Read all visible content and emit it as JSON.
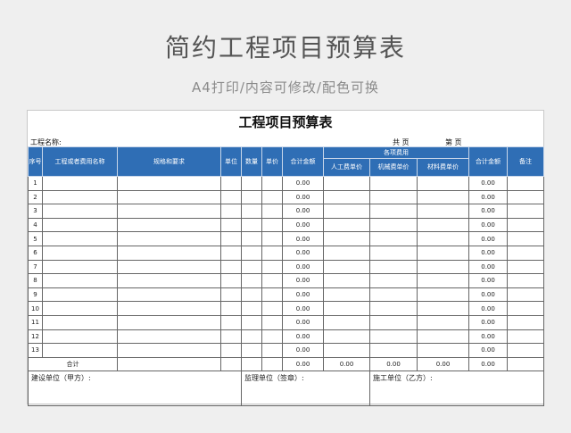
{
  "promo": {
    "title": "简约工程项目预算表",
    "subtitle": "A4打印/内容可修改/配色可换"
  },
  "sheet": {
    "title": "工程项目预算表",
    "project_label": "工程名称:",
    "page_total_label": "共      页",
    "page_current_label": "第      页"
  },
  "headers": {
    "seq": "序号",
    "name": "工程或者费用名称",
    "spec": "规格和要求",
    "unit": "单位",
    "qty": "数量",
    "price": "单价",
    "total": "合计金额",
    "costs_group": "各项费用",
    "labor": "人工费单价",
    "machine": "机械费单价",
    "material": "材料费单价",
    "total2": "合计金额",
    "remark": "备注"
  },
  "rows": [
    {
      "no": "1",
      "total": "0.00",
      "total2": "0.00"
    },
    {
      "no": "2",
      "total": "0.00",
      "total2": "0.00"
    },
    {
      "no": "3",
      "total": "0.00",
      "total2": "0.00"
    },
    {
      "no": "4",
      "total": "0.00",
      "total2": "0.00"
    },
    {
      "no": "5",
      "total": "0.00",
      "total2": "0.00"
    },
    {
      "no": "6",
      "total": "0.00",
      "total2": "0.00"
    },
    {
      "no": "7",
      "total": "0.00",
      "total2": "0.00"
    },
    {
      "no": "8",
      "total": "0.00",
      "total2": "0.00"
    },
    {
      "no": "9",
      "total": "0.00",
      "total2": "0.00"
    },
    {
      "no": "10",
      "total": "0.00",
      "total2": "0.00"
    },
    {
      "no": "11",
      "total": "0.00",
      "total2": "0.00"
    },
    {
      "no": "12",
      "total": "0.00",
      "total2": "0.00"
    },
    {
      "no": "13",
      "total": "0.00",
      "total2": "0.00"
    }
  ],
  "sum_row": {
    "label": "合计",
    "total": "0.00",
    "labor": "0.00",
    "machine": "0.00",
    "material": "0.00",
    "total2": "0.00"
  },
  "signatures": {
    "builder": "建设单位（甲方）:",
    "supervisor": "监理单位（签章）:",
    "contractor": "施工单位（乙方）:"
  }
}
